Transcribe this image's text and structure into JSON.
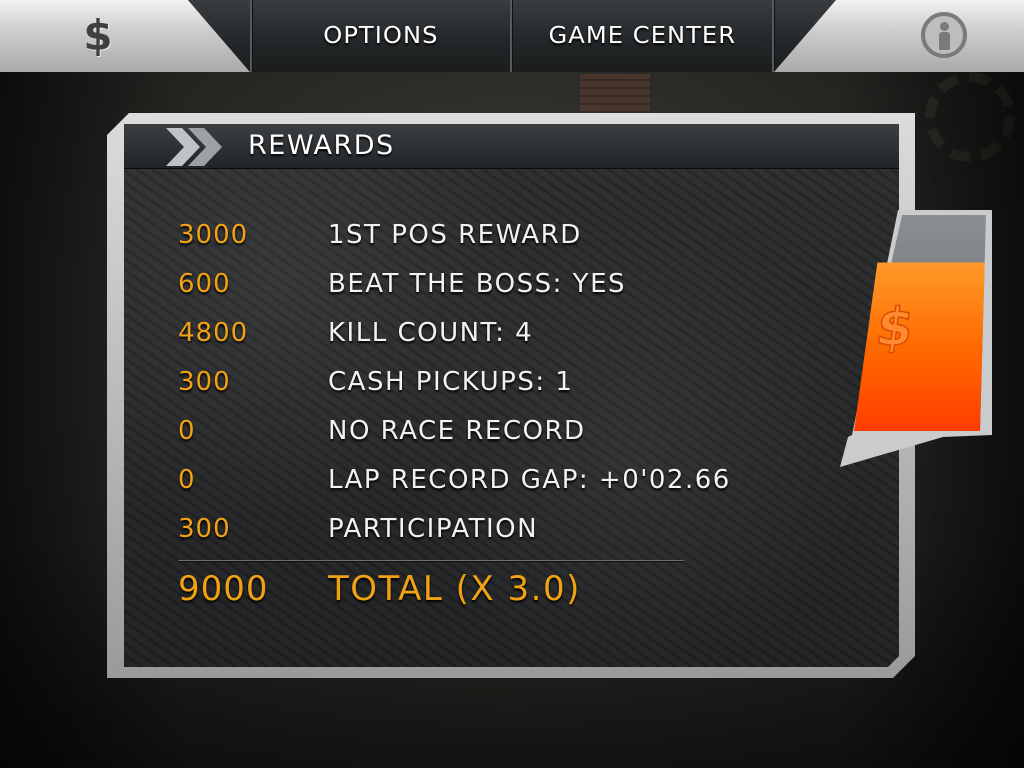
{
  "topbar": {
    "cash_icon": "dollar-icon",
    "options_label": "OPTIONS",
    "game_center_label": "GAME CENTER",
    "info_icon": "info-person-icon"
  },
  "panel": {
    "title": "REWARDS",
    "rows": [
      {
        "value": "3000",
        "label": "1ST POS REWARD"
      },
      {
        "value": "600",
        "label": "BEAT THE BOSS: YES"
      },
      {
        "value": "4800",
        "label": "KILL COUNT: 4"
      },
      {
        "value": "300",
        "label": "CASH PICKUPS: 1"
      },
      {
        "value": "0",
        "label": "NO RACE RECORD"
      },
      {
        "value": "0",
        "label": "LAP RECORD GAP: +0'02.66"
      },
      {
        "value": "300",
        "label": "PARTICIPATION"
      }
    ],
    "total": {
      "value": "9000",
      "label": "TOTAL (X 3.0)"
    }
  },
  "gauge": {
    "icon": "dollar-icon",
    "fill_level": 0.78
  },
  "colors": {
    "accent_orange": "#f0a214",
    "gauge_orange": "#ff6a00"
  }
}
